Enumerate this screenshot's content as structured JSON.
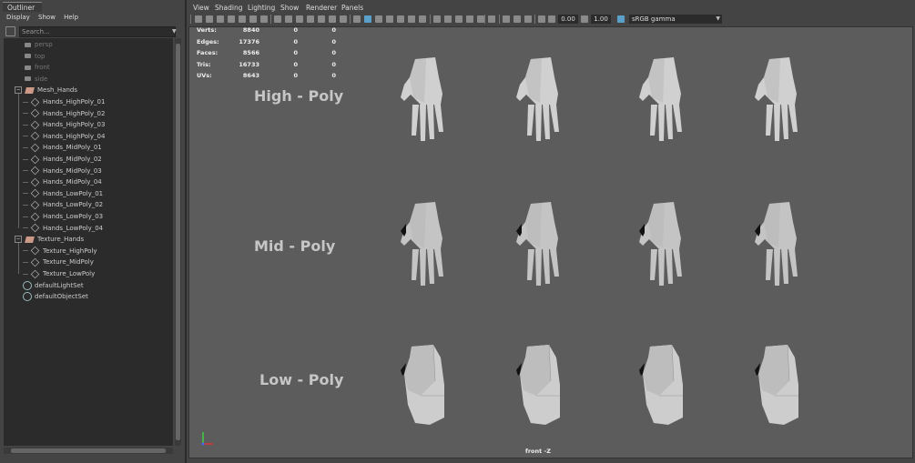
{
  "outliner": {
    "tab_title": "Outliner",
    "menu": [
      "Display",
      "Show",
      "Help"
    ],
    "search_placeholder": "Search...",
    "items": [
      {
        "label": "persp",
        "icon": "camera-icon",
        "depth": 1,
        "dim": true
      },
      {
        "label": "top",
        "icon": "camera-icon",
        "depth": 1,
        "dim": true
      },
      {
        "label": "front",
        "icon": "camera-icon",
        "depth": 1,
        "dim": true
      },
      {
        "label": "side",
        "icon": "camera-icon",
        "depth": 1,
        "dim": true
      },
      {
        "label": "Mesh_Hands",
        "icon": "group-icon",
        "depth": 0,
        "expanded": true
      },
      {
        "label": "Hands_HighPoly_01",
        "icon": "mesh-icon",
        "depth": 1
      },
      {
        "label": "Hands_HighPoly_02",
        "icon": "mesh-icon",
        "depth": 1
      },
      {
        "label": "Hands_HighPoly_03",
        "icon": "mesh-icon",
        "depth": 1
      },
      {
        "label": "Hands_HighPoly_04",
        "icon": "mesh-icon",
        "depth": 1
      },
      {
        "label": "Hands_MidPoly_01",
        "icon": "mesh-icon",
        "depth": 1
      },
      {
        "label": "Hands_MidPoly_02",
        "icon": "mesh-icon",
        "depth": 1
      },
      {
        "label": "Hands_MidPoly_03",
        "icon": "mesh-icon",
        "depth": 1
      },
      {
        "label": "Hands_MidPoly_04",
        "icon": "mesh-icon",
        "depth": 1
      },
      {
        "label": "Hands_LowPoly_01",
        "icon": "mesh-icon",
        "depth": 1
      },
      {
        "label": "Hands_LowPoly_02",
        "icon": "mesh-icon",
        "depth": 1
      },
      {
        "label": "Hands_LowPoly_03",
        "icon": "mesh-icon",
        "depth": 1
      },
      {
        "label": "Hands_LowPoly_04",
        "icon": "mesh-icon",
        "depth": 1
      },
      {
        "label": "Texture_Hands",
        "icon": "group-icon",
        "depth": 0,
        "expanded": true
      },
      {
        "label": "Texture_HighPoly",
        "icon": "mesh-icon",
        "depth": 1
      },
      {
        "label": "Texture_MidPoly",
        "icon": "mesh-icon",
        "depth": 1
      },
      {
        "label": "Texture_LowPoly",
        "icon": "mesh-icon",
        "depth": 1
      },
      {
        "label": "defaultLightSet",
        "icon": "set-icon",
        "depth": 0
      },
      {
        "label": "defaultObjectSet",
        "icon": "set-icon",
        "depth": 0
      }
    ]
  },
  "viewport": {
    "menu": [
      "View",
      "Shading",
      "Lighting",
      "Show",
      "Renderer",
      "Panels"
    ],
    "toolbar": {
      "exposure_value": "0.00",
      "gamma_value": "1.00",
      "color_space": "sRGB gamma"
    },
    "hud": {
      "rows": [
        {
          "label": "Verts:",
          "values": [
            "8840",
            "0",
            "0"
          ]
        },
        {
          "label": "Edges:",
          "values": [
            "17376",
            "0",
            "0"
          ]
        },
        {
          "label": "Faces:",
          "values": [
            "8566",
            "0",
            "0"
          ]
        },
        {
          "label": "Tris:",
          "values": [
            "16733",
            "0",
            "0"
          ]
        },
        {
          "label": "UVs:",
          "values": [
            "8643",
            "0",
            "0"
          ]
        }
      ]
    },
    "row_labels": [
      "High - Poly",
      "Mid - Poly",
      "Low - Poly"
    ],
    "camera_label": "front -Z",
    "colors": {
      "viewport_bg": "#5c5c5c",
      "panel_bg": "#444444",
      "accent": "#5aa0c8"
    }
  }
}
